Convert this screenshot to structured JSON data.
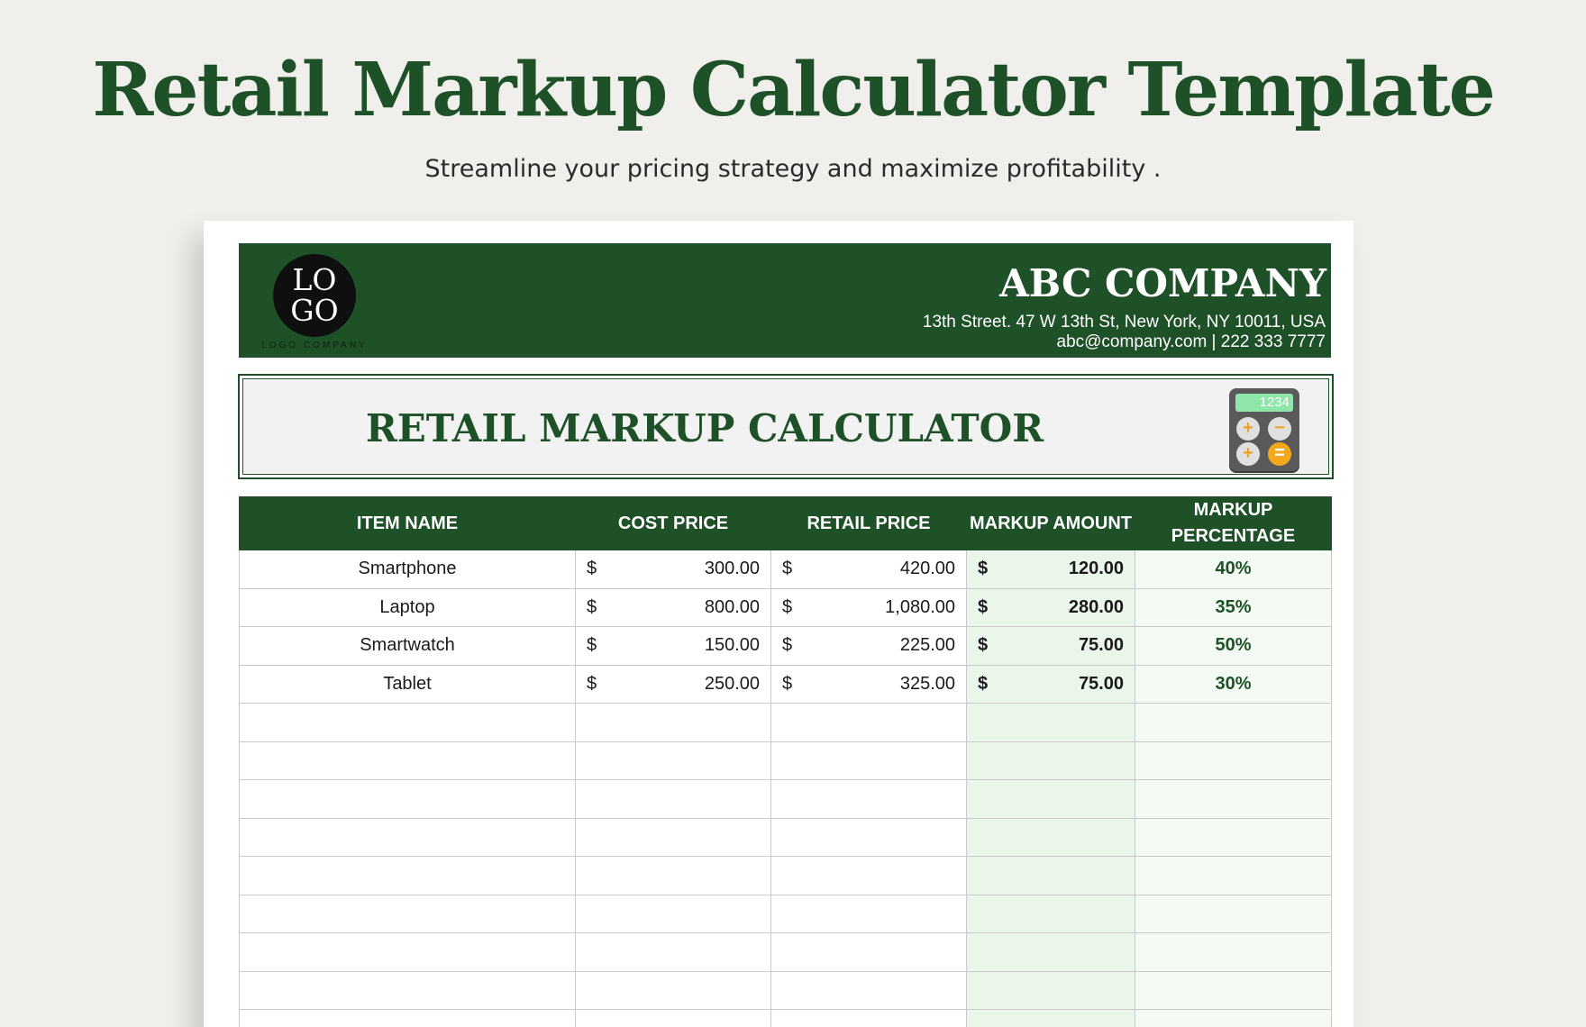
{
  "page": {
    "title": "Retail Markup Calculator Template",
    "subtitle": "Streamline your pricing strategy and maximize profitability ."
  },
  "header": {
    "logo_line1": "LO",
    "logo_line2": "GO",
    "logo_caption": "LOGO COMPANY",
    "company_name": "ABC COMPANY",
    "address": "13th Street. 47 W 13th St, New York, NY 10011, USA",
    "contact": "abc@company.com  |  222 333 7777"
  },
  "calculator": {
    "title": "RETAIL MARKUP CALCULATOR",
    "icon": "calculator-icon",
    "icon_screen": "1234"
  },
  "table": {
    "columns": [
      "ITEM NAME",
      "COST PRICE",
      "RETAIL PRICE",
      "MARKUP AMOUNT",
      "MARKUP PERCENTAGE"
    ],
    "currency": "$",
    "rows": [
      {
        "item": "Smartphone",
        "cost": "300.00",
        "retail": "420.00",
        "markup": "120.00",
        "pct": "40%"
      },
      {
        "item": "Laptop",
        "cost": "800.00",
        "retail": "1,080.00",
        "markup": "280.00",
        "pct": "35%"
      },
      {
        "item": "Smartwatch",
        "cost": "150.00",
        "retail": "225.00",
        "markup": "75.00",
        "pct": "50%"
      },
      {
        "item": "Tablet",
        "cost": "250.00",
        "retail": "325.00",
        "markup": "75.00",
        "pct": "30%"
      }
    ]
  },
  "colors": {
    "brand_green": "#1e5128",
    "markup_fill": "#eaf6ea",
    "background": "#f0efeb"
  }
}
